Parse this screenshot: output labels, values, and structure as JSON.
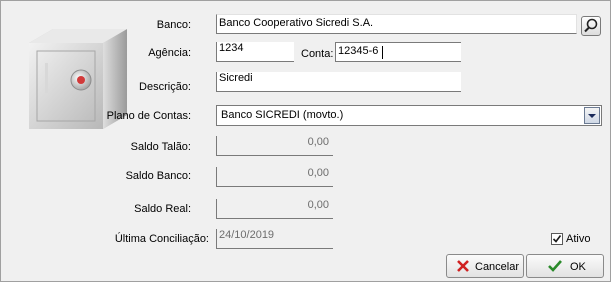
{
  "form": {
    "banco_label": "Banco:",
    "banco_value": "Banco Cooperativo Sicredi S.A.",
    "agencia_label": "Agência:",
    "agencia_value": "1234",
    "conta_label": "Conta:",
    "conta_value": "12345-6",
    "descricao_label": "Descrição:",
    "descricao_value": "Sicredi",
    "plano_label": "Plano de Contas:",
    "plano_value": "Banco SICREDI (movto.)",
    "saldo_talao_label": "Saldo Talão:",
    "saldo_talao_value": "0,00",
    "saldo_banco_label": "Saldo Banco:",
    "saldo_banco_value": "0,00",
    "saldo_real_label": "Saldo Real:",
    "saldo_real_value": "0,00",
    "ultima_conciliacao_label": "Última Conciliação:",
    "ultima_conciliacao_value": "24/10/2019",
    "ativo_label": "Ativo",
    "ativo_checked": true
  },
  "buttons": {
    "cancel_label": "Cancelar",
    "ok_label": "OK"
  },
  "icons": {
    "search": "search-icon",
    "dropdown": "chevron-down-icon",
    "cancel": "x-icon",
    "ok": "checkmark-icon",
    "safe": "safe-icon"
  },
  "colors": {
    "cancel_x": "#d02020",
    "ok_check": "#2a8a2a",
    "dropdown_arrow": "#1a2a5a"
  }
}
